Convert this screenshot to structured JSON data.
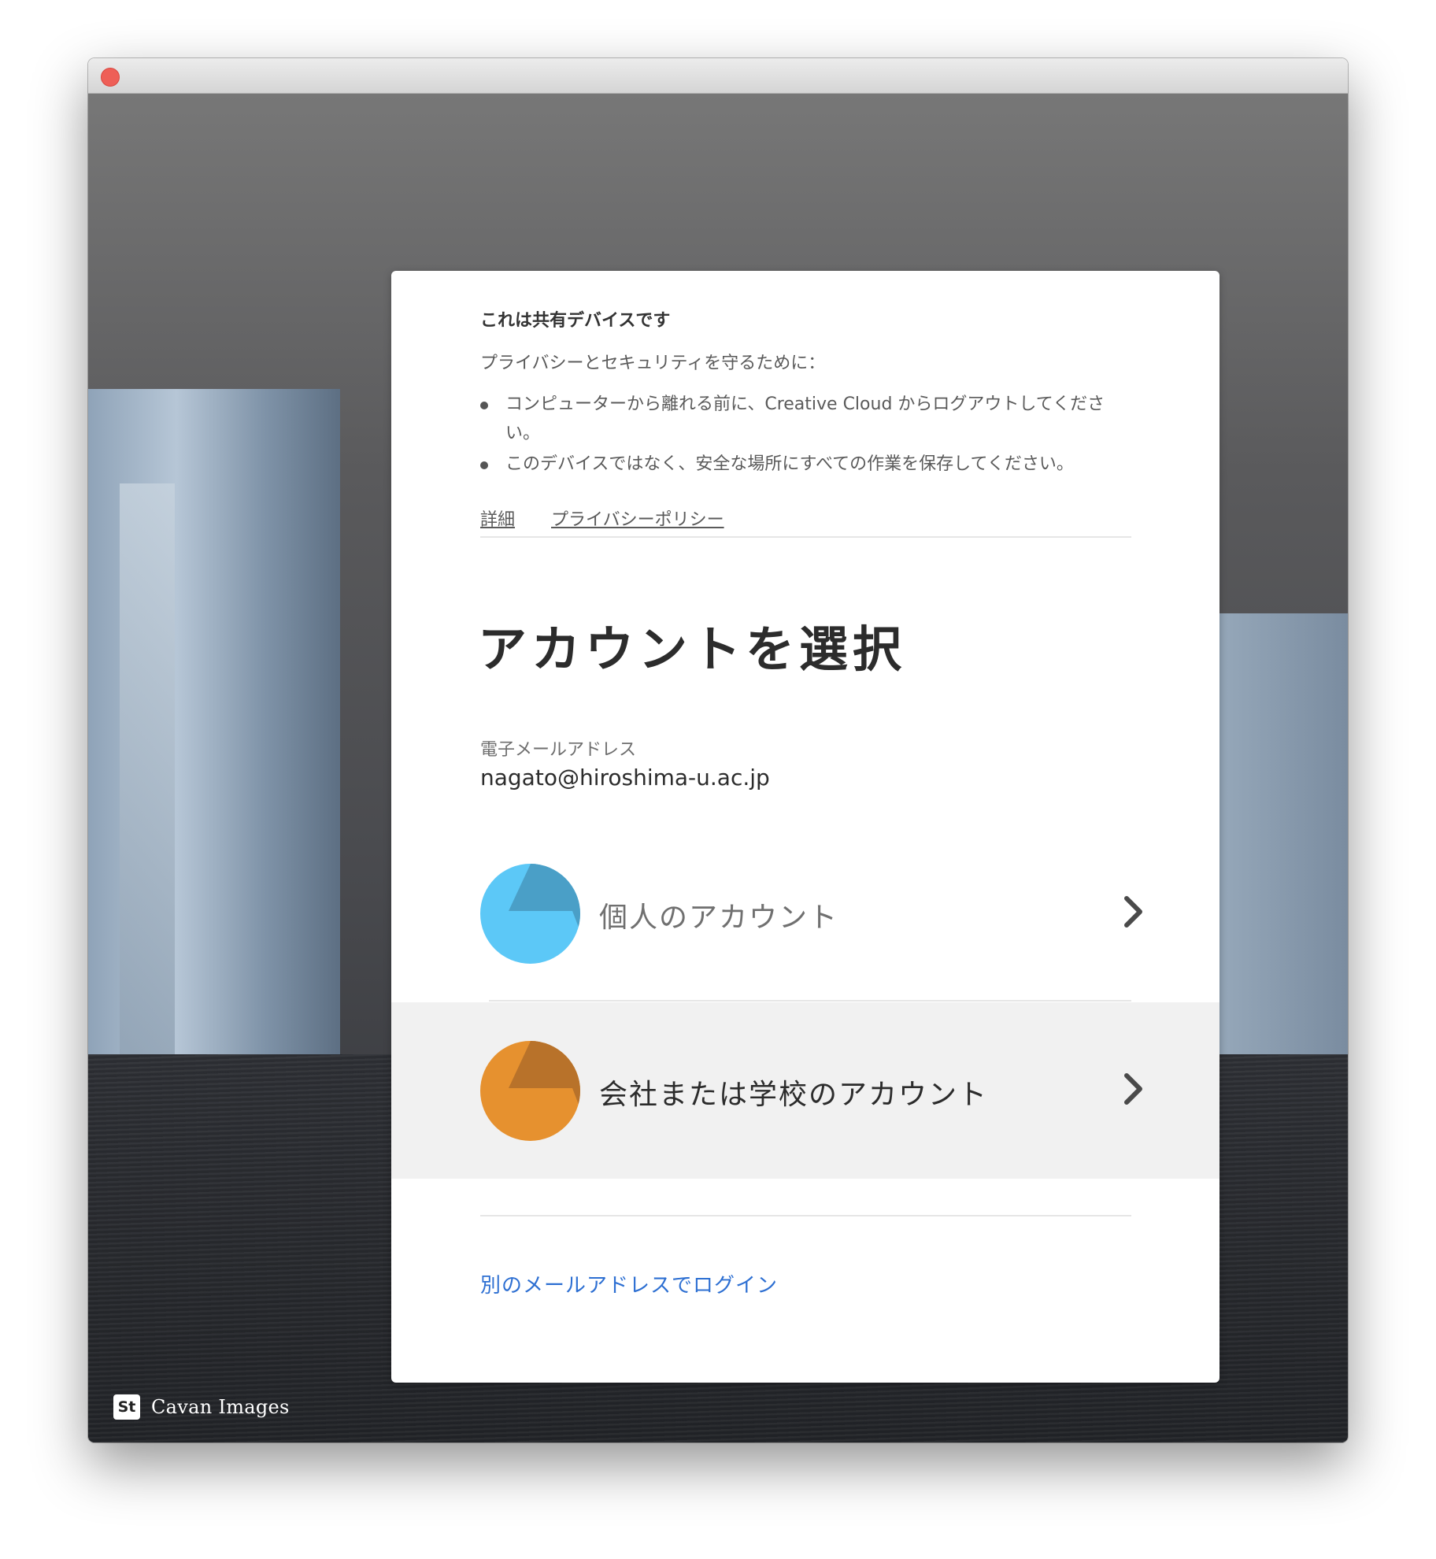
{
  "window": {
    "close_button": "close"
  },
  "background": {
    "credit_logo": "St",
    "credit_text": "Cavan Images"
  },
  "notice": {
    "title": "これは共有デバイスです",
    "intro": "プライバシーとセキュリティを守るために：",
    "bullets": [
      "コンピューターから離れる前に、Creative Cloud からログアウトしてください。",
      "このデバイスではなく、安全な場所にすべての作業を保存してください。"
    ],
    "links": {
      "details": "詳細",
      "privacy": "プライバシーポリシー"
    }
  },
  "account_select": {
    "heading": "アカウントを選択",
    "email_label": "電子メールアドレス",
    "email_value": "nagato@hiroshima-u.ac.jp",
    "accounts": [
      {
        "label": "個人のアカウント",
        "avatar_color": "#5cc8f7",
        "avatar_shade": "#4a9fc7",
        "text_color": "#707070",
        "icon": "chevron-right-icon"
      },
      {
        "label": "会社または学校のアカウント",
        "avatar_color": "#e6912f",
        "avatar_shade": "#b8722a",
        "text_color": "#2c2c2c",
        "icon": "chevron-right-icon"
      }
    ],
    "alt_login": "別のメールアドレスでログイン"
  },
  "colors": {
    "link_blue": "#2d6fd2",
    "row_hover": "#f1f1f1"
  }
}
